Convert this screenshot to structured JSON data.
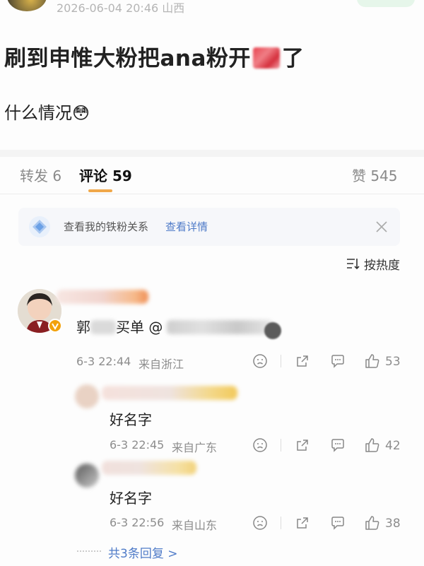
{
  "post": {
    "timestamp": "2026-06-04 20:46 山西",
    "title_before": "刷到申惟大粉把ana粉开",
    "title_after": "了",
    "subtitle_text": "什么情况",
    "subtitle_emoji": "😳"
  },
  "tabs": {
    "repost": "转发 6",
    "comments": "评论 59",
    "likes": "赞 545"
  },
  "banner": {
    "text": "查看我的铁粉关系",
    "link": "查看详情"
  },
  "sort": {
    "label": "按热度"
  },
  "comments": [
    {
      "text": "郭",
      "text_2": "买单 @",
      "time": "6-3 22:44",
      "location": "来自浙江",
      "likes": "53"
    }
  ],
  "replies": [
    {
      "text": "好名字",
      "time": "6-3 22:45",
      "location": "来自广东",
      "likes": "42"
    },
    {
      "text": "好名字",
      "time": "6-3 22:56",
      "location": "来自山东",
      "likes": "38"
    }
  ],
  "more_replies": "共3条回复 >",
  "colors": {
    "accent_blue": "#4f7bc8",
    "muted": "#9a9a9a",
    "verified": "#f2a10b"
  }
}
